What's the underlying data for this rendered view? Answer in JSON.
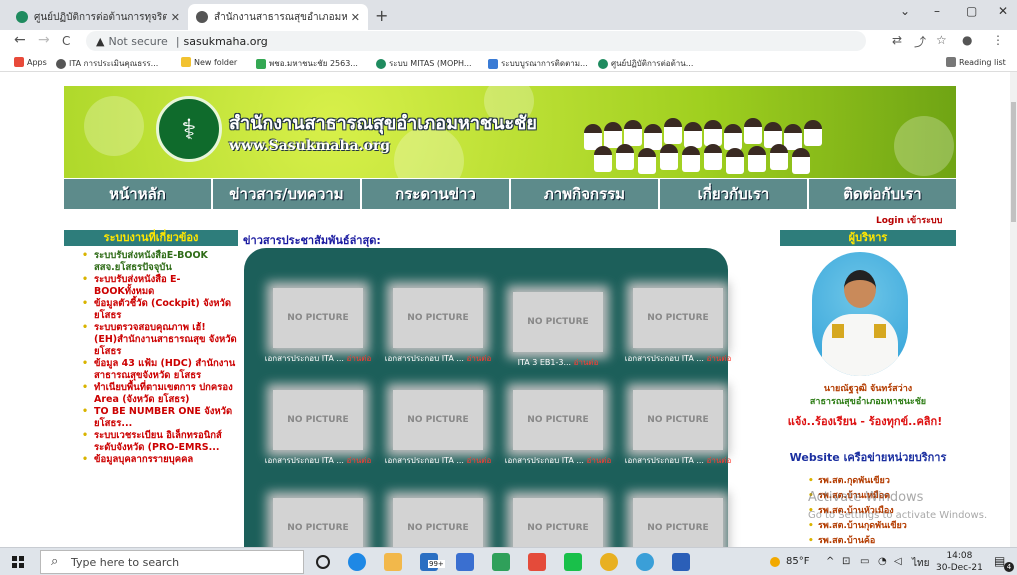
{
  "browser": {
    "tabs": [
      {
        "label": "ศูนย์ปฏิบัติการต่อต้านการทุจริต กระทร...",
        "active": false
      },
      {
        "label": "สำนักงานสาธารณสุขอำเภอมหาชนะชัย",
        "active": true
      }
    ],
    "new_tab": "+",
    "window_controls": [
      "⌄",
      "–",
      "▢",
      "✕"
    ],
    "nav": {
      "back": "←",
      "forward": "→",
      "reload": "C"
    },
    "address": {
      "warning_icon": "▲",
      "security": "Not secure",
      "separator": "|",
      "url": "sasukmaha.org"
    },
    "bookmarks": [
      {
        "label": "Apps",
        "color": "#e84a3a"
      },
      {
        "label": "ITA การประเมินคุณธรร...",
        "color": "#555555"
      },
      {
        "label": "New folder",
        "color": "#f2c230"
      },
      {
        "label": "พชอ.มหาชนะชัย 2563...",
        "color": "#34a853"
      },
      {
        "label": "ระบบ MITAS (MOPH...",
        "color": "#1f8b5f"
      },
      {
        "label": "ระบบบูรณาการติดตาม...",
        "color": "#3a7bd5"
      },
      {
        "label": "ศูนย์ปฏิบัติการต่อต้าน...",
        "color": "#1f8b5f"
      }
    ],
    "reading_list": "Reading list"
  },
  "site": {
    "banner_title": "สำนักงานสาธารณสุขอำเภอมหาชนะชัย",
    "banner_url": "www.Sasukmaha.org",
    "menu": [
      "หน้าหลัก",
      "ข่าวสาร/บทความ",
      "กระดานข่าว",
      "ภาพกิจกรรม",
      "เกี่ยวกับเรา",
      "ติดต่อกับเรา"
    ],
    "login": "Login เข้าระบบ",
    "left_heading": "ระบบงานที่เกี่ยวข้อง",
    "left_links": [
      {
        "text": "ระบบรับส่งหนังสือE-BOOK สสจ.ยโสธรปัจจุบัน",
        "tone": "g"
      },
      {
        "text": "ระบบรับส่งหนังสือ E-BOOKทั้งหมด",
        "tone": "r"
      },
      {
        "text": "ข้อมูลตัวชี้วัด (Cockpit) จังหวัดยโสธร",
        "tone": "r"
      },
      {
        "text": "ระบบตรวจสอบคุณภาพ เฮ้! (EH)สำนักงานสาธารณสุข จังหวัดยโสธร",
        "tone": "r"
      },
      {
        "text": "ข้อมูล 43 แฟ้ม (HDC) สำนักงานสาธารณสุขจังหวัด ยโสธร",
        "tone": "r"
      },
      {
        "text": "ทำเนียบพื้นที่ตามเขตการ ปกครอง Area (จังหวัด ยโสธร)",
        "tone": "r"
      },
      {
        "text": "TO BE NUMBER ONE จังหวัด ยโสธร...",
        "tone": "r"
      },
      {
        "text": "ระบบเวชระเบียน อิเล็กทรอนิกส์ระดับจังหวัด (PRO-EMRS...",
        "tone": "r"
      },
      {
        "text": "ข้อมูลบุคลากรรายบุคคล",
        "tone": "r"
      }
    ],
    "news_heading": "ข่าวสารประชาสัมพันธ์ล่าสุด:",
    "thumb_placeholder": "NO PICTURE",
    "read_more": "อ่านต่อ",
    "news_items": [
      "เอกสารประกอบ ITA ...",
      "เอกสารประกอบ ITA ...",
      "ITA 3 EB1-3...",
      "เอกสารประกอบ ITA ...",
      "เอกสารประกอบ ITA ...",
      "เอกสารประกอบ ITA ...",
      "เอกสารประกอบ ITA ...",
      "เอกสารประกอบ ITA ...",
      "",
      "",
      "",
      ""
    ],
    "right_heading": "ผู้บริหาร",
    "director_name": "นายณัฐวุฒิ จันทร์สว่าง",
    "director_org": "สาธารณสุขอำเภอมหาชนะชัย",
    "complaint": "แจ้ง..ร้องเรียน - ร้องทุกข์..คลิก!",
    "website_heading": "Website เครือข่ายหน่วยบริการ",
    "network": [
      "รพ.สต.กุดพันเขียว",
      "รพ.สต.บ้านเหมือด",
      "รพ.สต.บ้านหัวเมือง",
      "รพ.สต.บ้านกุดพันเขียว",
      "รพ.สต.บ้านค้อ"
    ],
    "watermark1": "Activate Windows",
    "watermark2": "Go to Settings to activate Windows."
  },
  "taskbar": {
    "search_placeholder": "Type here to search",
    "weather": "85°F",
    "lang": "ไทย",
    "time": "14:08",
    "date": "30-Dec-21",
    "notif_count": "4",
    "mail_badge": "99+"
  }
}
